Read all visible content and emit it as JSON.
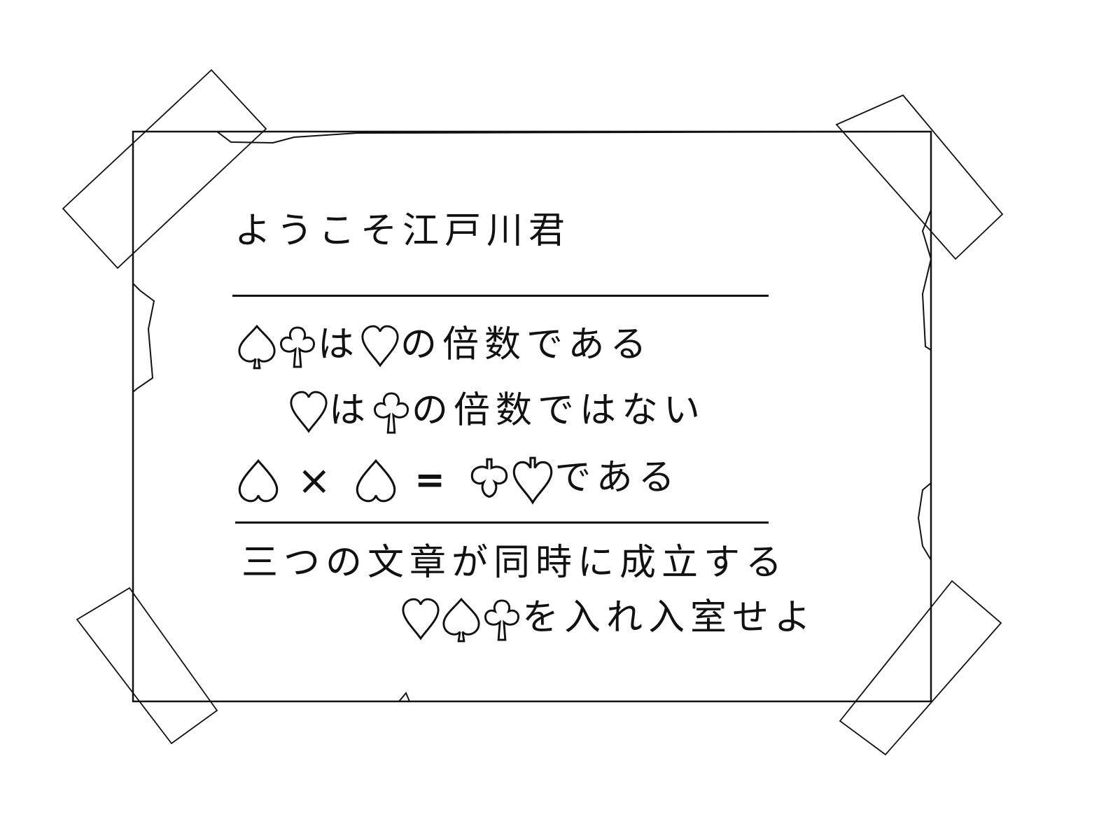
{
  "note": {
    "greeting": "ようこそ江戸川君",
    "line1_mid": "は",
    "line1_end": "の倍数である",
    "line2_mid": "は",
    "line2_end": "の倍数ではない",
    "line3_times": "×",
    "line3_equals": "=",
    "line3_end": "である",
    "line4": "三つの文章が同時に成立する",
    "line5_end": "を入れ入室せよ"
  },
  "icons": {
    "spade": "spade-outline-icon",
    "club": "club-outline-icon",
    "heart": "heart-outline-icon",
    "heart_top": "heart-top-half-icon",
    "club_bottom": "club-without-stem-icon",
    "heart_with_stem": "heart-with-stem-icon"
  },
  "colors": {
    "ink": "#111111",
    "paper": "#ffffff"
  }
}
